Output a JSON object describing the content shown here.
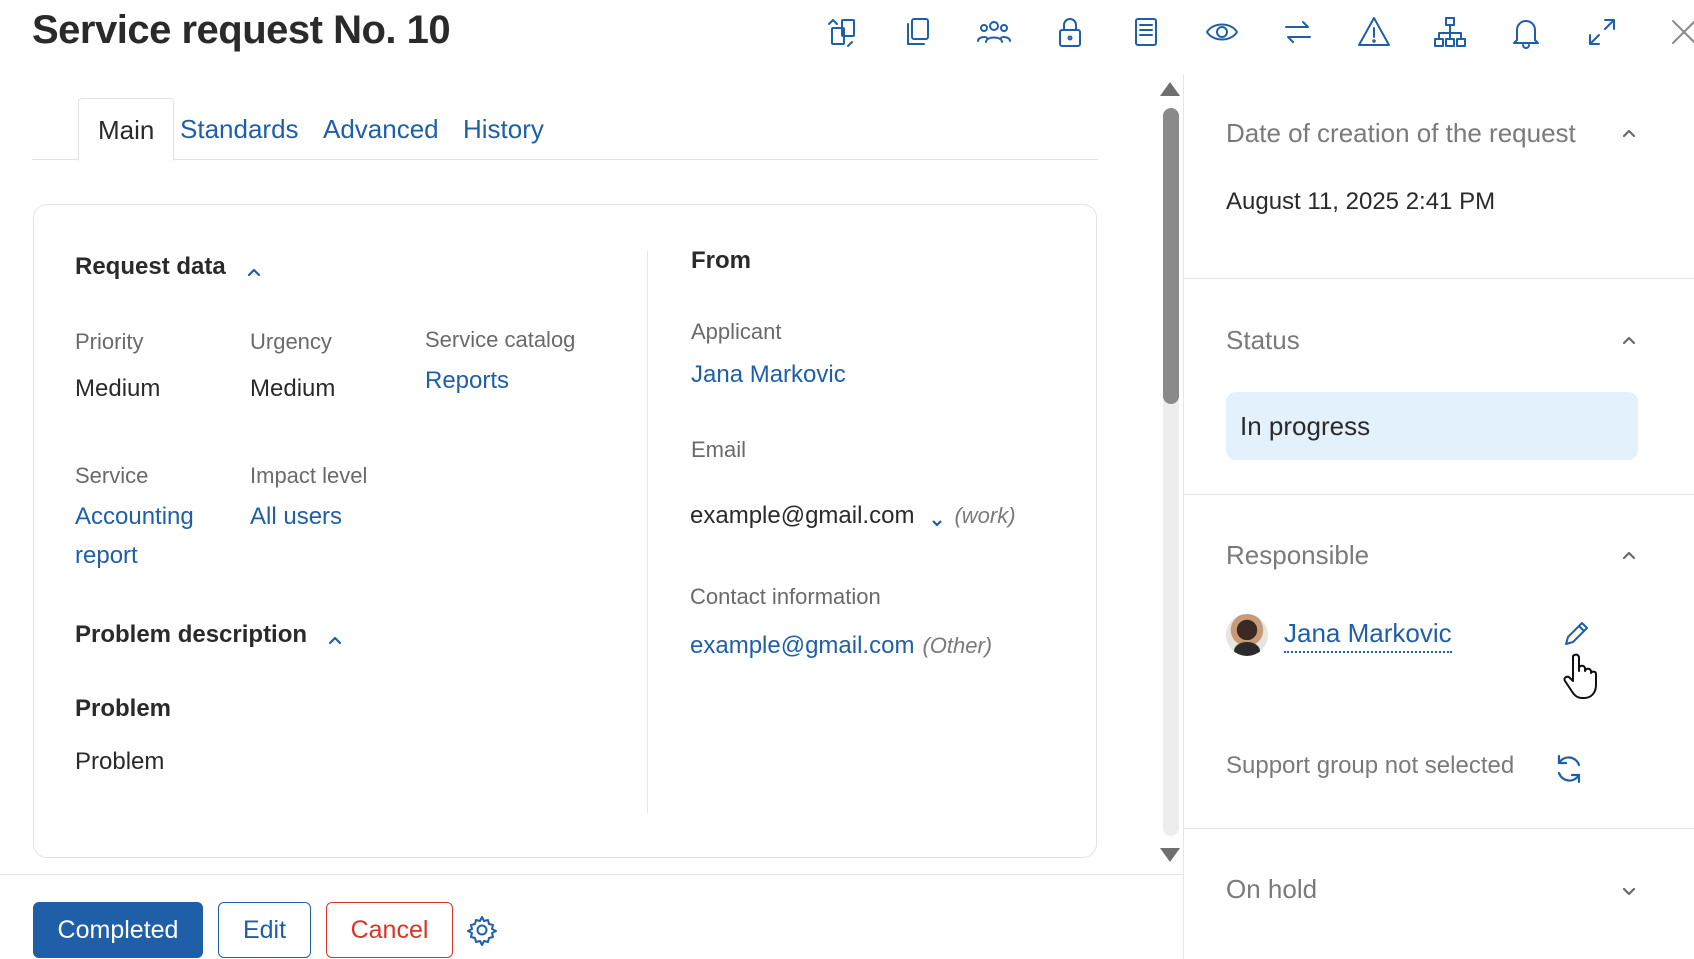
{
  "header": {
    "title": "Service request No. 10",
    "toolbar_icons": [
      "convert-icon",
      "copy-icon",
      "users-icon",
      "lock-icon",
      "book-icon",
      "eye-icon",
      "transfer-icon",
      "warning-icon",
      "hierarchy-icon",
      "bell-icon",
      "expand-icon",
      "close-icon"
    ]
  },
  "tabs": [
    {
      "label": "Main",
      "active": true
    },
    {
      "label": "Standards",
      "active": false
    },
    {
      "label": "Advanced",
      "active": false
    },
    {
      "label": "History",
      "active": false
    }
  ],
  "request_data": {
    "title": "Request data",
    "priority_label": "Priority",
    "priority_value": "Medium",
    "urgency_label": "Urgency",
    "urgency_value": "Medium",
    "service_catalog_label": "Service catalog",
    "service_catalog_value": "Reports",
    "service_label": "Service",
    "service_value_line1": "Accounting",
    "service_value_line2": "report",
    "impact_label": "Impact level",
    "impact_value": "All users"
  },
  "problem": {
    "section_title": "Problem description",
    "label": "Problem",
    "value": "Problem"
  },
  "from": {
    "title": "From",
    "applicant_label": "Applicant",
    "applicant_value": "Jana Markovic",
    "email_label": "Email",
    "email_value": "example@gmail.com",
    "email_type": "(work)",
    "contact_label": "Contact information",
    "contact_value": "example@gmail.com",
    "contact_type": "(Other)"
  },
  "right_panel": {
    "date_header": "Date of creation of the request",
    "date_value": "August 11, 2025 2:41 PM",
    "status_header": "Status",
    "status_value": "In progress",
    "responsible_header": "Responsible",
    "responsible_name": "Jana Markovic",
    "support_group_text": "Support group not selected",
    "on_hold_header": "On hold"
  },
  "footer": {
    "completed_label": "Completed",
    "edit_label": "Edit",
    "cancel_label": "Cancel"
  },
  "colors": {
    "accent": "#1f5fa8",
    "cancel": "#d9342b",
    "status_bg": "#e3f1fc"
  }
}
